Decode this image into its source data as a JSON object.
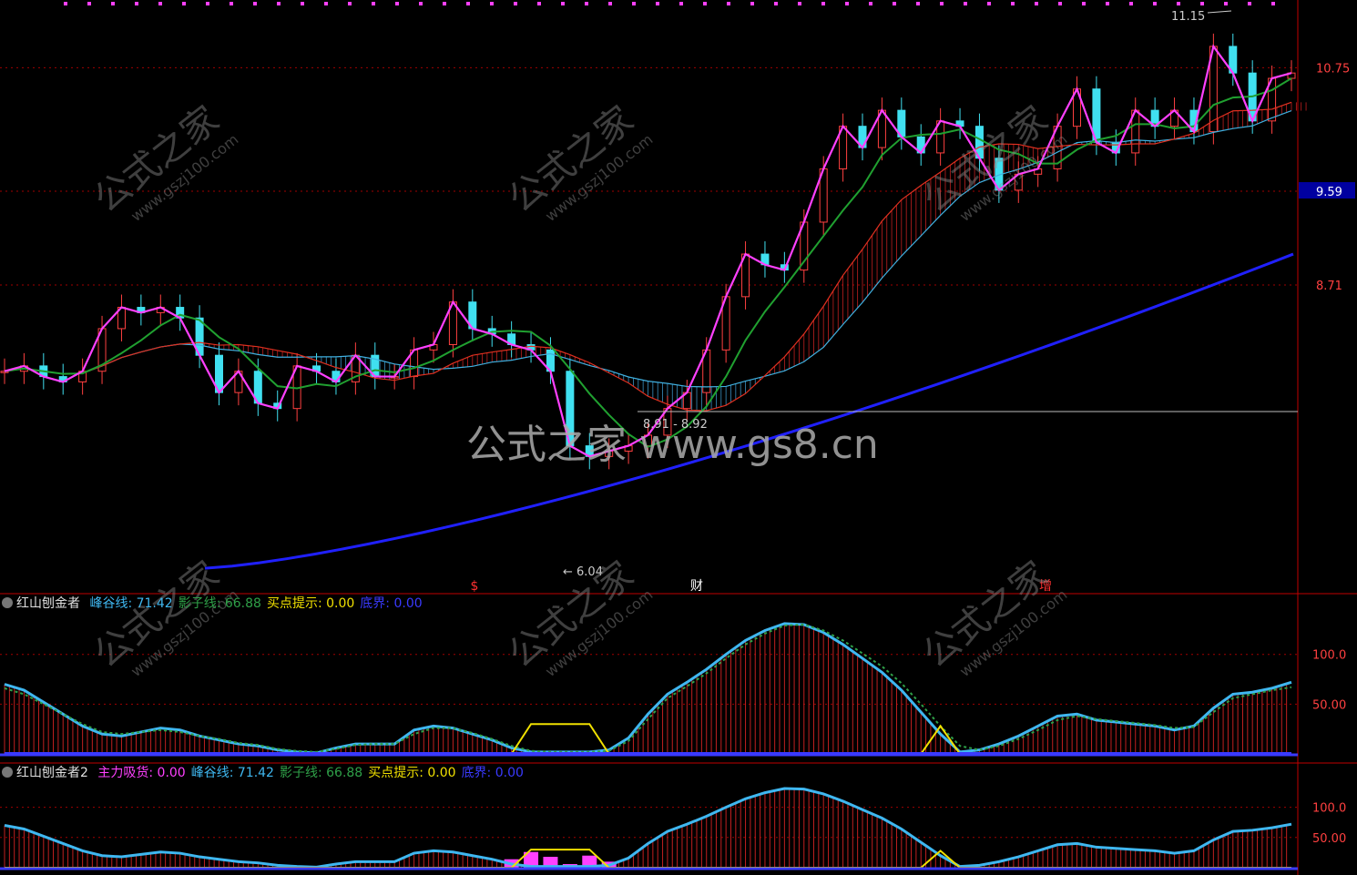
{
  "app": {
    "watermark_center": "公式之家 www.gs8.cn",
    "watermark_small_cn": "公式之家",
    "watermark_small_url": "www.gszj100.com"
  },
  "main_panel": {
    "price_axis": [
      "10.75",
      "9.59",
      "8.71"
    ],
    "current_price_label": "9.59",
    "high_marker": "11.15",
    "low_marker": "6.04",
    "range_marker": "8.91 - 8.92",
    "event_markers": [
      {
        "label": "$",
        "color": "#ff3030"
      },
      {
        "label": "财",
        "color": "#ffffff"
      },
      {
        "label": "增",
        "color": "#ff3030"
      }
    ]
  },
  "indicator1": {
    "name": "红山刨金者",
    "items": [
      {
        "label": "峰谷线:",
        "value": "71.42",
        "color": "#3fb7f0"
      },
      {
        "label": "影子线:",
        "value": "66.88",
        "color": "#2fa048"
      },
      {
        "label": "买点提示:",
        "value": "0.00",
        "color": "#f0e000"
      },
      {
        "label": "底界:",
        "value": "0.00",
        "color": "#3a3aff"
      }
    ],
    "axis": [
      "100.0",
      "50.00"
    ]
  },
  "indicator2": {
    "name": "红山刨金者2",
    "items": [
      {
        "label": "主力吸货:",
        "value": "0.00",
        "color": "#ff40ff"
      },
      {
        "label": "峰谷线:",
        "value": "71.42",
        "color": "#3fb7f0"
      },
      {
        "label": "影子线:",
        "value": "66.88",
        "color": "#2fa048"
      },
      {
        "label": "买点提示:",
        "value": "0.00",
        "color": "#f0e000"
      },
      {
        "label": "底界:",
        "value": "0.00",
        "color": "#3a3aff"
      }
    ],
    "axis": [
      "100.0",
      "50.00"
    ]
  },
  "chart_data": [
    {
      "type": "candlestick",
      "panel": "price",
      "title": "",
      "y_ticks": [
        10.75,
        9.59,
        8.71
      ],
      "ylim": [
        6.0,
        11.3
      ],
      "annotations": [
        {
          "text": "11.15",
          "kind": "high"
        },
        {
          "text": "6.04",
          "kind": "low"
        },
        {
          "text": "8.91 - 8.92",
          "kind": "level"
        }
      ],
      "close_series_approx": [
        7.9,
        7.95,
        7.85,
        7.8,
        7.9,
        8.3,
        8.5,
        8.45,
        8.5,
        8.4,
        8.05,
        7.7,
        7.9,
        7.6,
        7.55,
        7.95,
        7.9,
        7.8,
        8.05,
        7.85,
        7.85,
        8.1,
        8.15,
        8.55,
        8.3,
        8.25,
        8.15,
        8.1,
        7.9,
        7.2,
        7.1,
        7.15,
        7.2,
        7.3,
        7.55,
        7.7,
        8.1,
        8.6,
        9.0,
        8.9,
        8.85,
        9.3,
        9.8,
        10.2,
        10.0,
        10.35,
        10.1,
        9.95,
        10.25,
        10.2,
        9.9,
        9.6,
        9.75,
        9.8,
        10.2,
        10.55,
        10.05,
        9.95,
        10.35,
        10.2,
        10.35,
        10.15,
        10.95,
        10.7,
        10.25,
        10.65,
        10.7
      ],
      "series": [
        {
          "name": "",
          "color": "#ff40ff",
          "kind": "close-line"
        },
        {
          "name": "",
          "color": "#20a030",
          "kind": "ma-green"
        },
        {
          "name": "",
          "color": "#e03020",
          "kind": "ma-red"
        },
        {
          "name": "",
          "color": "#40b0e0",
          "kind": "ma-blue"
        },
        {
          "name": "",
          "color": "#2020ff",
          "kind": "ma-long"
        }
      ]
    },
    {
      "type": "bar",
      "panel": "indicator1",
      "title": "",
      "ylim": [
        0,
        140
      ],
      "y_ticks": [
        100.0,
        50.0
      ],
      "series": [
        {
          "name": "峰谷线",
          "color": "#3fb7f0",
          "values": [
            70,
            64,
            52,
            40,
            28,
            20,
            18,
            22,
            26,
            24,
            18,
            14,
            10,
            8,
            4,
            2,
            1,
            6,
            10,
            10,
            10,
            24,
            28,
            26,
            20,
            14,
            6,
            2,
            2,
            2,
            2,
            4,
            16,
            40,
            60,
            72,
            85,
            100,
            114,
            124,
            131,
            130,
            122,
            110,
            96,
            82,
            64,
            42,
            20,
            2,
            4,
            10,
            18,
            28,
            38,
            40,
            34,
            32,
            30,
            28,
            24,
            28,
            46,
            60,
            62,
            66,
            72
          ]
        },
        {
          "name": "影子线",
          "color": "#2fa048",
          "values": [
            66,
            60,
            50,
            40,
            30,
            22,
            20,
            22,
            24,
            22,
            18,
            15,
            11,
            9,
            5,
            3,
            2,
            5,
            9,
            10,
            10,
            20,
            26,
            26,
            21,
            15,
            8,
            3,
            2,
            2,
            2,
            3,
            13,
            35,
            56,
            68,
            81,
            96,
            110,
            121,
            129,
            130,
            124,
            114,
            101,
            88,
            71,
            50,
            28,
            8,
            4,
            8,
            15,
            24,
            34,
            38,
            35,
            33,
            31,
            29,
            26,
            27,
            42,
            56,
            60,
            64,
            67
          ]
        },
        {
          "name": "买点提示",
          "color": "#f0e000",
          "values": [
            0,
            0,
            0,
            0,
            0,
            0,
            0,
            0,
            0,
            0,
            0,
            0,
            0,
            0,
            0,
            0,
            0,
            0,
            0,
            0,
            0,
            0,
            0,
            0,
            0,
            0,
            0,
            30,
            30,
            30,
            30,
            0,
            0,
            0,
            0,
            0,
            0,
            0,
            0,
            0,
            0,
            0,
            0,
            0,
            0,
            0,
            0,
            0,
            28,
            0,
            0,
            0,
            0,
            0,
            0,
            0,
            0,
            0,
            0,
            0,
            0,
            0,
            0,
            0,
            0,
            0,
            0
          ]
        },
        {
          "name": "底界",
          "color": "#3a3aff",
          "values": [
            0,
            0,
            0,
            0,
            0,
            0,
            0,
            0,
            0,
            0,
            0,
            0,
            0,
            0,
            0,
            0,
            0,
            0,
            0,
            0,
            0,
            0,
            0,
            0,
            0,
            0,
            0,
            0,
            0,
            0,
            0,
            0,
            0,
            0,
            0,
            0,
            0,
            0,
            0,
            0,
            0,
            0,
            0,
            0,
            0,
            0,
            0,
            0,
            0,
            0,
            0,
            0,
            0,
            0,
            0,
            0,
            0,
            0,
            0,
            0,
            0,
            0,
            0,
            0,
            0,
            0,
            0
          ]
        }
      ]
    },
    {
      "type": "bar",
      "panel": "indicator2",
      "title": "",
      "ylim": [
        0,
        140
      ],
      "y_ticks": [
        100.0,
        50.0
      ],
      "series": [
        {
          "name": "峰谷线",
          "color": "#3fb7f0",
          "values": [
            70,
            64,
            52,
            40,
            28,
            20,
            18,
            22,
            26,
            24,
            18,
            14,
            10,
            8,
            4,
            2,
            1,
            6,
            10,
            10,
            10,
            24,
            28,
            26,
            20,
            14,
            6,
            2,
            2,
            2,
            2,
            4,
            16,
            40,
            60,
            72,
            85,
            100,
            114,
            124,
            131,
            130,
            122,
            110,
            96,
            82,
            64,
            42,
            20,
            2,
            4,
            10,
            18,
            28,
            38,
            40,
            34,
            32,
            30,
            28,
            24,
            28,
            46,
            60,
            62,
            66,
            72
          ]
        },
        {
          "name": "主力吸货",
          "color": "#ff40ff",
          "values": [
            0,
            0,
            0,
            0,
            0,
            0,
            0,
            0,
            0,
            0,
            0,
            0,
            0,
            0,
            0,
            0,
            0,
            0,
            0,
            0,
            0,
            0,
            0,
            0,
            0,
            0,
            14,
            26,
            18,
            6,
            20,
            10,
            0,
            0,
            0,
            0,
            0,
            0,
            0,
            0,
            0,
            0,
            0,
            0,
            0,
            0,
            0,
            0,
            0,
            0,
            0,
            0,
            0,
            0,
            0,
            0,
            0,
            0,
            0,
            0,
            0,
            0,
            0,
            0,
            0,
            0,
            0
          ]
        },
        {
          "name": "买点提示",
          "color": "#f0e000",
          "values": [
            0,
            0,
            0,
            0,
            0,
            0,
            0,
            0,
            0,
            0,
            0,
            0,
            0,
            0,
            0,
            0,
            0,
            0,
            0,
            0,
            0,
            0,
            0,
            0,
            0,
            0,
            0,
            30,
            30,
            30,
            30,
            0,
            0,
            0,
            0,
            0,
            0,
            0,
            0,
            0,
            0,
            0,
            0,
            0,
            0,
            0,
            0,
            0,
            28,
            0,
            0,
            0,
            0,
            0,
            0,
            0,
            0,
            0,
            0,
            0,
            0,
            0,
            0,
            0,
            0,
            0,
            0
          ]
        }
      ]
    }
  ]
}
